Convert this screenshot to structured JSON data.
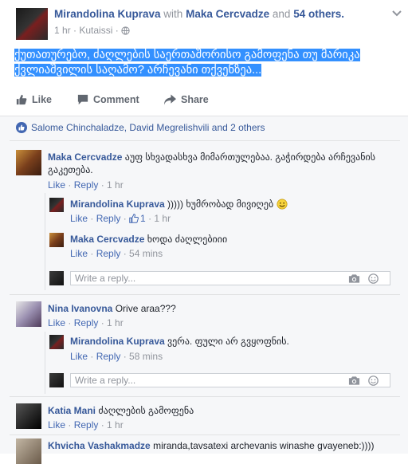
{
  "post": {
    "author": "Mirandolina Kuprava",
    "with_text": "with",
    "tagged": "Maka Cercvadze",
    "and_text": "and",
    "others": "54 others.",
    "time": "1 hr",
    "location": "Kutaissi",
    "text": "ქუთათურებო, ძაღლების საერთაშორისო გამოფენა თუ მარიკა ქვლიაშვილის საღამო? არჩევანი თქვენზეა..."
  },
  "actions": {
    "like": "Like",
    "comment": "Comment",
    "share": "Share"
  },
  "likes_line": "Salome Chinchaladze, David Megrelishvili and 2 others",
  "common": {
    "like": "Like",
    "reply": "Reply",
    "placeholder": "Write a reply..."
  },
  "comments": [
    {
      "name": "Maka Cercvadze",
      "text": "აუფ სხვადასხვა მიმართულებაა. გაჭირდება არჩევანის გაკეთება.",
      "time": "1 hr",
      "replies": [
        {
          "name": "Mirandolina Kuprava",
          "text": ")))))  ხუმრობად მივიღებ",
          "likes": "1",
          "time": "1 hr"
        },
        {
          "name": "Maka Cercvadze",
          "text": "ხოდა ძაღლებიიი",
          "time": "54 mins"
        }
      ]
    },
    {
      "name": "Nina Ivanovna",
      "text": "Orive araa???",
      "time": "1 hr",
      "replies": [
        {
          "name": "Mirandolina Kuprava",
          "text": "ვერა. ფული არ გვყოფნის.",
          "time": "58 mins"
        }
      ]
    },
    {
      "name": "Katia Mani",
      "text": "ძაღლების გამოფენა",
      "time": "1 hr"
    },
    {
      "name": "Khvicha Vashakmadze",
      "text": "miranda,tavsatexi archevanis winashe gvayeneb:))))"
    }
  ]
}
